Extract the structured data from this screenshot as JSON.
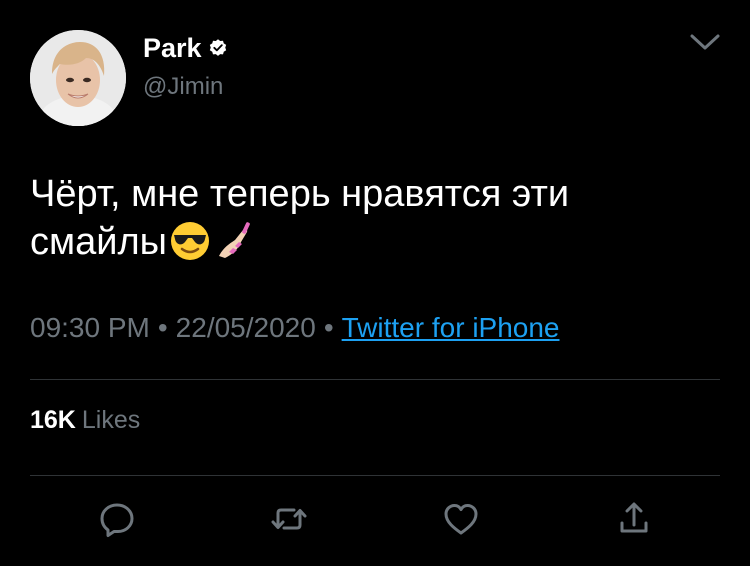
{
  "author": {
    "display_name": "Park",
    "handle": "@Jimin",
    "verified": true,
    "avatar_icon": "person-avatar"
  },
  "tweet": {
    "text_line1": "Чёрт, мне теперь нравятся эти",
    "text_line2": "смайлы",
    "emojis": [
      "smiling-face-with-sunglasses-emoji",
      "nail-polish-emoji"
    ]
  },
  "meta": {
    "time": "09:30 PM",
    "separator": "•",
    "date": "22/05/2020",
    "source": "Twitter for iPhone"
  },
  "stats": {
    "likes_count": "16K",
    "likes_label": "Likes"
  },
  "actions": [
    "reply-icon",
    "retweet-icon",
    "like-icon",
    "share-icon"
  ],
  "colors": {
    "background": "#000000",
    "text": "#ffffff",
    "secondary": "#6e767d",
    "link": "#1da1f2",
    "divider": "#2f3336"
  }
}
